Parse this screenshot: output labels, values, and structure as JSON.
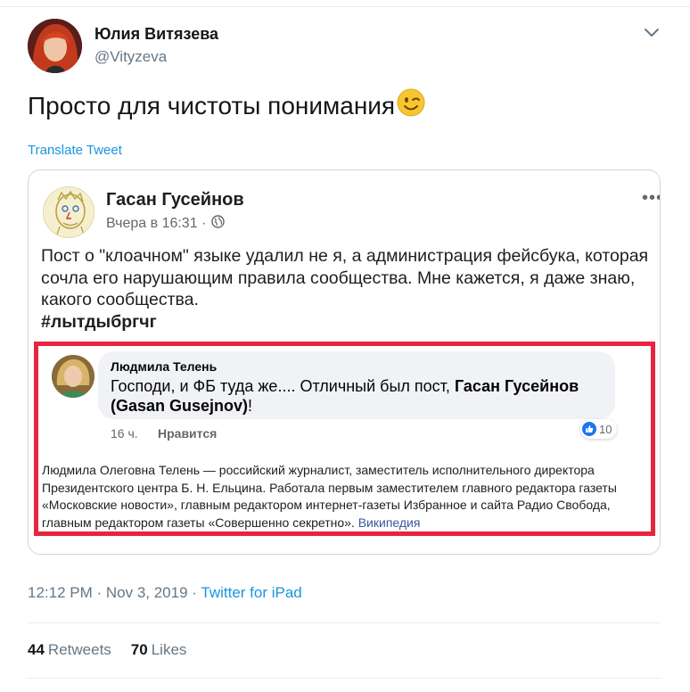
{
  "tweet": {
    "author_name": "Юлия Витязева",
    "author_handle": "@Vityzeva",
    "text": "Просто для чистоты понимания",
    "emoji": "winking-face",
    "translate_label": "Translate Tweet",
    "time": "12:12 PM",
    "separator": " · ",
    "date": "Nov 3, 2019",
    "source": "Twitter for iPad",
    "retweets_count": "44",
    "retweets_label": "Retweets",
    "likes_count": "70",
    "likes_label": "Likes"
  },
  "fb_post": {
    "author": "Гасан Гусейнов",
    "time": "Вчера в 16:31 ·",
    "more": "•••",
    "text": "Пост о \"клоачном\" языке удалил не я, а администрация фейсбука, которая сочла его нарушающим правила сообщества. Мне кажется, я даже знаю, какого сообщества.",
    "hashtag": "#лытдыбргчг"
  },
  "fb_comment": {
    "author": "Людмила Телень",
    "text_before": "Господи, и ФБ туда же.... Отличный был пост, ",
    "mention": "Гасан Гусейнов (Gasan Gusejnov)",
    "text_after": "!",
    "time": "16 ч.",
    "like_label": "Нравится",
    "reactions_count": "10"
  },
  "wiki_snippet": {
    "text": "Людмила Олеговна Телень — российский журналист, заместитель исполнительного директора Президентского центра Б. Н. Ельцина. Работала первым заместителем главного редактора газеты «Московские новости», главным редактором интернет-газеты Избранное и сайта Радио Свобода, главным редактором газеты «Совершенно секретно».",
    "source": "Википедия"
  },
  "colors": {
    "twitter_blue": "#1b95e0",
    "frame_red": "#e8243e",
    "fb_blue": "#1877f2"
  }
}
